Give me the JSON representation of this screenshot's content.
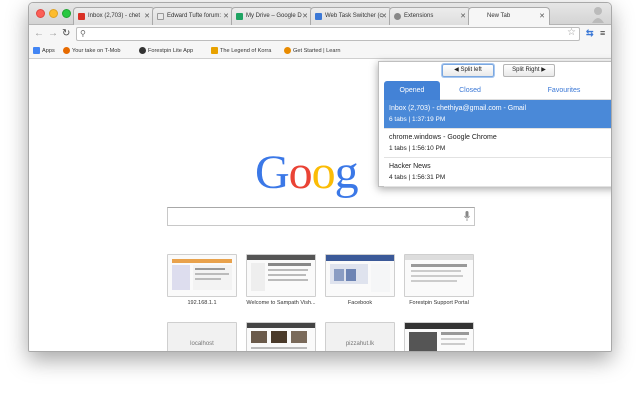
{
  "tabs": [
    {
      "title": "Inbox (2,703) - chet",
      "color": "#d93025"
    },
    {
      "title": "Edward Tufte forum:",
      "color": "#e8e8e8"
    },
    {
      "title": "My Drive – Google D",
      "color": "#1fa463"
    },
    {
      "title": "Web Task Switcher (c",
      "color": "#3b78d6"
    },
    {
      "title": "Extensions",
      "color": "#888888"
    },
    {
      "title": "New Tab",
      "color": ""
    }
  ],
  "bookmarks": [
    {
      "label": "Apps",
      "color": "#4285f4"
    },
    {
      "label": "Your take on T-Mob",
      "color": "#e66a00"
    },
    {
      "label": "Forestpin Lite App",
      "color": "#333333"
    },
    {
      "label": "The Legend of Korra",
      "color": "#e8a200"
    },
    {
      "label": "Get Started | Learn",
      "color": "#e88b00"
    }
  ],
  "logo": {
    "letters": [
      "G",
      "o",
      "o",
      "g"
    ],
    "colors": [
      "#3b78e7",
      "#ea4335",
      "#fbbc05",
      "#3b78e7"
    ]
  },
  "thumbnails": [
    {
      "label": "192.168.1.1",
      "placeholder": ""
    },
    {
      "label": "Welcome to Sampath Vish...",
      "placeholder": ""
    },
    {
      "label": "Facebook",
      "placeholder": ""
    },
    {
      "label": "Forestpin Support Portal",
      "placeholder": ""
    },
    {
      "label": "",
      "placeholder": "localhost"
    },
    {
      "label": "",
      "placeholder": ""
    },
    {
      "label": "",
      "placeholder": "pizzahut.lk"
    },
    {
      "label": "",
      "placeholder": ""
    }
  ],
  "popup": {
    "split_left": "Split left",
    "split_right": "Split Right",
    "close": "✕",
    "tabs": [
      "Opened",
      "Closed",
      "Favourites"
    ],
    "windows": [
      {
        "title": "Inbox (2,703) - chethiya@gmail.com - Gmail",
        "sub": "6 tabs | 1:37:19 PM"
      },
      {
        "title": "chrome.windows - Google Chrome",
        "sub": "1 tabs | 1:56:10 PM"
      },
      {
        "title": "Hacker News",
        "sub": "4 tabs | 1:56:31 PM"
      }
    ]
  },
  "icons": {
    "star": "☆",
    "star_filled": "★",
    "close": "✖"
  }
}
